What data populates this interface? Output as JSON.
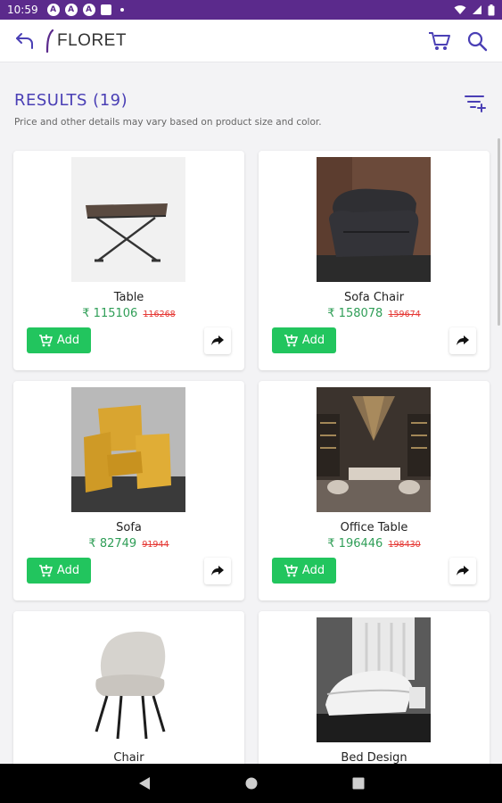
{
  "status_bar": {
    "time": "10:59",
    "notif_icons": [
      "A",
      "A",
      "A"
    ]
  },
  "app_bar": {
    "logo_text": "FLORET",
    "icons": [
      "back-arrow-icon",
      "cart-icon",
      "search-icon"
    ],
    "accent_color": "#4a3fb5"
  },
  "results": {
    "title": "RESULTS (19)",
    "subtitle": "Price and other details may vary based on product size and color."
  },
  "products": [
    {
      "name": "Table",
      "price": "₹ 115106",
      "mrp": "116268",
      "add_label": "Add"
    },
    {
      "name": "Sofa Chair",
      "price": "₹ 158078",
      "mrp": "159674",
      "add_label": "Add"
    },
    {
      "name": "Sofa",
      "price": "₹ 82749",
      "mrp": "91944",
      "add_label": "Add"
    },
    {
      "name": "Office Table",
      "price": "₹ 196446",
      "mrp": "198430",
      "add_label": "Add"
    },
    {
      "name": "Chair",
      "price": "",
      "mrp": "",
      "add_label": ""
    },
    {
      "name": "Bed Design",
      "price": "",
      "mrp": "",
      "add_label": ""
    }
  ],
  "colors": {
    "status_bar": "#5b2a8c",
    "add_button": "#22c55e",
    "price": "#2f9e57",
    "mrp": "#e53935"
  }
}
